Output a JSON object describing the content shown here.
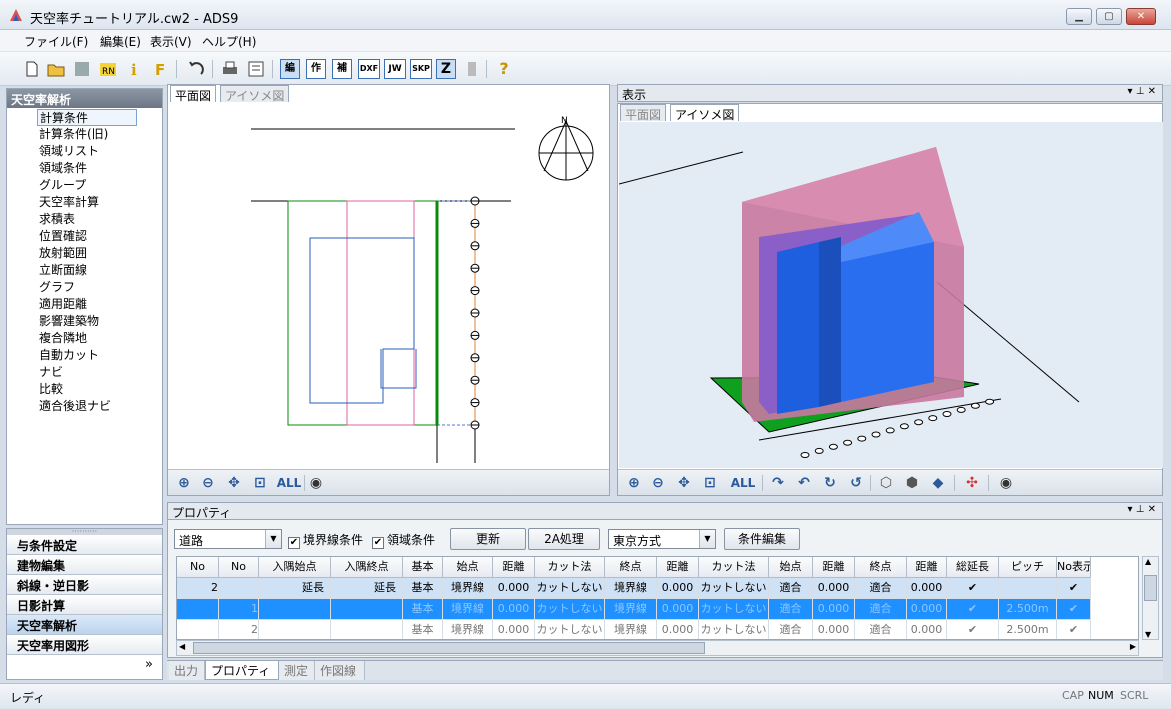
{
  "window": {
    "title": "天空率チュートリアル.cw2 - ADS9",
    "min_label": "▁",
    "max_label": "▢",
    "close_label": "✕"
  },
  "menu": [
    "ファイル(F)",
    "編集(E)",
    "表示(V)",
    "ヘルプ(H)"
  ],
  "toolbar": {
    "boxed_labels": [
      "編",
      "作",
      "補",
      "DXF",
      "JW",
      "SKP",
      "Z"
    ],
    "help_label": "?"
  },
  "left_panel": {
    "title": "天空率解析",
    "items": [
      "計算条件",
      "計算条件(旧)",
      "領域リスト",
      "領域条件",
      "グループ",
      "天空率計算",
      "求積表",
      "位置確認",
      "放射範囲",
      "立断面線",
      "グラフ",
      "適用距離",
      "影響建築物",
      "複合隣地",
      "自動カット",
      "ナビ",
      "比較",
      "適合後退ナビ"
    ],
    "selected_index": 0
  },
  "left_nav": {
    "items": [
      "与条件設定",
      "建物編集",
      "斜線・逆日影",
      "日影計算",
      "天空率解析",
      "天空率用図形"
    ],
    "selected_index": 4,
    "more_label": "»"
  },
  "plan_view": {
    "tabs": [
      "平面図",
      "アイソメ図"
    ],
    "selected_tab": 0,
    "north_label": "N",
    "all_label": "ALL"
  },
  "iso_view": {
    "header": "表示",
    "tabs": [
      "平面図",
      "アイソメ図"
    ],
    "selected_tab": 1,
    "all_label": "ALL"
  },
  "properties": {
    "header": "プロパティ",
    "type_combo": "道路",
    "chk_boundary": "境界線条件",
    "chk_region": "領域条件",
    "update_button": "更新",
    "process_button": "2A処理",
    "method_combo": "東京方式",
    "edit_button": "条件編集",
    "columns": [
      "No",
      "No",
      "入隅始点",
      "入隅終点",
      "基本",
      "始点",
      "距離",
      "カット法",
      "終点",
      "距離",
      "カット法",
      "始点",
      "距離",
      "終点",
      "距離",
      "総延長",
      "ピッチ",
      "No表示"
    ],
    "rows": [
      [
        "2",
        "",
        "延長",
        "延長",
        "基本",
        "境界線",
        "0.000",
        "カットしない",
        "境界線",
        "0.000",
        "カットしない",
        "適合",
        "0.000",
        "適合",
        "0.000",
        "✔",
        "",
        "✔"
      ],
      [
        "",
        "1",
        "",
        "",
        "基本",
        "境界線",
        "0.000",
        "カットしない",
        "境界線",
        "0.000",
        "カットしない",
        "適合",
        "0.000",
        "適合",
        "0.000",
        "✔",
        "2.500m",
        "✔"
      ],
      [
        "",
        "2",
        "",
        "",
        "基本",
        "境界線",
        "0.000",
        "カットしない",
        "境界線",
        "0.000",
        "カットしない",
        "適合",
        "0.000",
        "適合",
        "0.000",
        "✔",
        "2.500m",
        "✔"
      ]
    ]
  },
  "bottom_tabs": [
    "出力",
    "プロパティ",
    "測定",
    "作図線"
  ],
  "bottom_selected": 1,
  "status": {
    "text": "レディ",
    "cap": "CAP",
    "num": "NUM",
    "scrl": "SCRL"
  }
}
